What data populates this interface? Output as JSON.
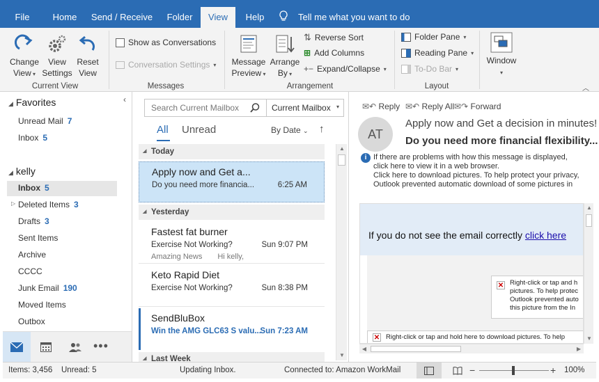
{
  "tabs": [
    "File",
    "Home",
    "Send / Receive",
    "Folder",
    "View",
    "Help"
  ],
  "tell_me": "Tell me what you want to do",
  "ribbon": {
    "change_view": [
      "Change",
      "View"
    ],
    "view_settings": [
      "View",
      "Settings"
    ],
    "reset_view": [
      "Reset",
      "View"
    ],
    "group_current_view": "Current View",
    "show_conversations": "Show as Conversations",
    "conversation_settings": "Conversation Settings",
    "group_messages": "Messages",
    "message_preview": [
      "Message",
      "Preview"
    ],
    "arrange_by": [
      "Arrange",
      "By"
    ],
    "reverse_sort": "Reverse Sort",
    "add_columns": "Add Columns",
    "expand_collapse": "Expand/Collapse",
    "group_arrangement": "Arrangement",
    "folder_pane": "Folder Pane",
    "reading_pane": "Reading Pane",
    "todo_bar": "To-Do Bar",
    "group_layout": "Layout",
    "window": "Window"
  },
  "folders": {
    "favorites_title": "Favorites",
    "favorites": [
      {
        "label": "Unread Mail",
        "count": "7"
      },
      {
        "label": "Inbox",
        "count": "5"
      }
    ],
    "account_title": "kelly",
    "items": [
      {
        "label": "Inbox",
        "count": "5"
      },
      {
        "label": "Deleted Items",
        "count": "3"
      },
      {
        "label": "Drafts",
        "count": "3"
      },
      {
        "label": "Sent Items",
        "count": ""
      },
      {
        "label": "Archive",
        "count": ""
      },
      {
        "label": "CCCC",
        "count": ""
      },
      {
        "label": "Junk Email",
        "count": "190"
      },
      {
        "label": "Moved Items",
        "count": ""
      },
      {
        "label": "Outbox",
        "count": ""
      }
    ]
  },
  "search": {
    "placeholder": "Search Current Mailbox",
    "scope": "Current Mailbox"
  },
  "list": {
    "filter_all": "All",
    "filter_unread": "Unread",
    "sort": "By Date",
    "group_today": "Today",
    "group_yesterday": "Yesterday",
    "group_last_week": "Last Week",
    "messages": [
      {
        "from": "Apply now and Get a...",
        "subject": "Do you need more financia...",
        "time": "6:25 AM",
        "preview": ""
      },
      {
        "from": "Fastest fat burner",
        "subject": "Exercise Not Working?",
        "time": "Sun 9:07 PM",
        "preview_from": "Amazing News",
        "preview": "Hi kelly,"
      },
      {
        "from": "Keto Rapid Diet",
        "subject": "Exercise Not Working?",
        "time": "Sun 8:38 PM",
        "preview": ""
      },
      {
        "from": "SendBluBox",
        "subject": "Win the AMG GLC63 S valu...",
        "time": "Sun 7:23 AM",
        "preview": ""
      }
    ]
  },
  "reading": {
    "reply": "Reply",
    "reply_all": "Reply All",
    "forward": "Forward",
    "avatar": "AT",
    "sender": "Apply now and Get a decision in minutes!",
    "subject": "Do you need more financial flexibility...",
    "info_lines": [
      "If there are problems with how this message is displayed,",
      "click here to view it in a web browser.",
      "Click here to download pictures. To help protect your privacy,",
      "Outlook prevented automatic download of some pictures in"
    ],
    "body_text": "If you do not see the email correctly",
    "body_link": "click here",
    "img1_lines": [
      "Right-click or tap and h",
      "pictures. To help protec",
      "Outlook prevented auto",
      "this picture from the In"
    ],
    "img2_text": "Right-click or tap and hold here to download pictures. To help"
  },
  "status": {
    "items": "Items: 3,456",
    "unread": "Unread: 5",
    "updating": "Updating Inbox.",
    "connected": "Connected to: Amazon WorkMail",
    "zoom": "100%"
  },
  "colors": {
    "accent": "#2b6cb4",
    "selected": "#cce4f7",
    "nav_selected": "#e6e6e6"
  }
}
